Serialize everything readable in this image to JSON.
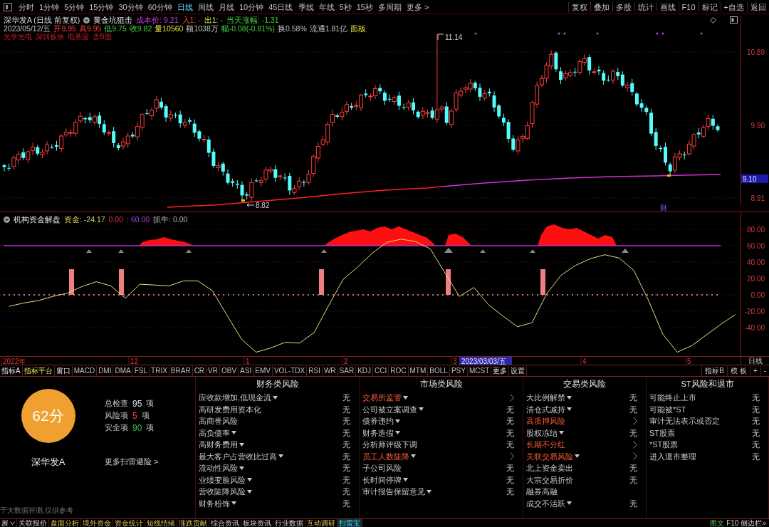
{
  "toolbar": {
    "periods": [
      {
        "label": "分时",
        "selected": false
      },
      {
        "label": "1分钟",
        "selected": false
      },
      {
        "label": "5分钟",
        "selected": false
      },
      {
        "label": "15分钟",
        "selected": false
      },
      {
        "label": "30分钟",
        "selected": false
      },
      {
        "label": "60分钟",
        "selected": false
      },
      {
        "label": "日线",
        "selected": true
      },
      {
        "label": "周线",
        "selected": false
      },
      {
        "label": "月线",
        "selected": false
      },
      {
        "label": "10分钟",
        "selected": false
      },
      {
        "label": "45日线",
        "selected": false
      },
      {
        "label": "季线",
        "selected": false
      },
      {
        "label": "年线",
        "selected": false
      },
      {
        "label": "5秒",
        "selected": false
      },
      {
        "label": "15秒",
        "selected": false
      },
      {
        "label": "多周期",
        "selected": false
      },
      {
        "label": "更多 >",
        "selected": false
      }
    ],
    "actions": [
      "复权",
      "叠加",
      "多股",
      "统计",
      "画线",
      "F10",
      "标记",
      "+自选",
      "返回"
    ]
  },
  "quote_header": {
    "title": "深华发A (日线 前复权)",
    "formula": "黄金坑狙击",
    "signals": [
      {
        "text": "成本价: 9.21",
        "kind": "cost"
      },
      {
        "text": "入1: -",
        "kind": "entry"
      },
      {
        "text": "出1: -",
        "kind": "exit"
      },
      {
        "text": "当天涨幅: -1.31",
        "kind": "change"
      }
    ],
    "quote": [
      {
        "text": "2023/05/12/五",
        "kind": "plain"
      },
      {
        "text": "开9.95",
        "kind": "up"
      },
      {
        "text": "高9.95",
        "kind": "up"
      },
      {
        "text": "低9.75",
        "kind": "down"
      },
      {
        "text": "收9.82",
        "kind": "down"
      },
      {
        "text": "量10560",
        "kind": "volume"
      },
      {
        "text": "额1038万",
        "kind": "plain"
      },
      {
        "text": "幅-0.08(-0.81%)",
        "kind": "down"
      },
      {
        "text": "换0.58%",
        "kind": "plain"
      },
      {
        "text": "流通1.81亿",
        "kind": "plain"
      },
      {
        "text": "面板",
        "kind": "volume"
      }
    ],
    "tags": [
      "光学光电",
      "深圳板块",
      "电基固",
      "含B股"
    ]
  },
  "price_chart": {
    "axis_labels": [
      "10.89",
      "9.90",
      "8.91"
    ],
    "current_price": "9.10",
    "high_label": "11.14",
    "low_label": "8.82",
    "event_marker": "财"
  },
  "indicator": {
    "name": "机构资金解盘",
    "readouts": [
      {
        "text": "资金: -24.17",
        "kind": "fund"
      },
      {
        "text": "0.00",
        "kind": "signal"
      },
      {
        "text": ": 60.00",
        "kind": "level"
      },
      {
        "text": "抓牛: 0.00",
        "kind": "plain"
      }
    ],
    "chart_data": {
      "type": "line",
      "grid": true,
      "ylim": [
        -74.8,
        100.9
      ],
      "yticks": [
        {
          "value": 80,
          "label": "80.00"
        },
        {
          "value": 60,
          "label": "60.00"
        },
        {
          "value": 40,
          "label": "40.00"
        },
        {
          "value": 20,
          "label": "20.00"
        },
        {
          "value": 0,
          "label": "0.00"
        },
        {
          "value": -20,
          "label": "-20.00"
        },
        {
          "value": -40,
          "label": "-40.00"
        }
      ],
      "ref_lines": [
        {
          "axis": "y",
          "value": 60,
          "color": "#b030d0"
        },
        {
          "axis": "y",
          "value": 0,
          "color": "#f0a0a0"
        }
      ],
      "series": [
        {
          "color": "#e8e080",
          "values": [
            -14,
            -10,
            -7,
            -2,
            2,
            10,
            16,
            11,
            -4,
            13,
            12,
            11,
            17,
            17,
            5,
            -25,
            -54,
            -70,
            -65,
            -58,
            -59,
            -46,
            -13,
            19,
            34,
            51,
            64,
            68,
            65,
            56,
            27,
            -2,
            9,
            -12,
            -26,
            -39,
            -34,
            1,
            24,
            36,
            44,
            49,
            45,
            30,
            -6,
            -48,
            -70,
            -62,
            -49,
            -36,
            -24
          ]
        }
      ]
    }
  },
  "time_axis": {
    "labels": [
      "2022年",
      "12",
      "1",
      "2",
      "3",
      "4",
      "5"
    ],
    "cursor_date": "2023/03/03/五",
    "period": "日线"
  },
  "indicator_tabs": {
    "left": [
      {
        "label": "指标A",
        "kind": "menu"
      },
      {
        "label": "指标平台",
        "kind": "platform"
      },
      {
        "label": "窗口",
        "kind": "menu"
      },
      {
        "label": "MACD",
        "kind": "formula"
      },
      {
        "label": "DMI",
        "kind": "formula"
      },
      {
        "label": "DMA",
        "kind": "formula"
      },
      {
        "label": "FSL",
        "kind": "formula"
      },
      {
        "label": "TRIX",
        "kind": "formula"
      },
      {
        "label": "BRAR",
        "kind": "formula"
      },
      {
        "label": "CR",
        "kind": "formula"
      },
      {
        "label": "VR",
        "kind": "formula"
      },
      {
        "label": "OBV",
        "kind": "formula"
      },
      {
        "label": "ASI",
        "kind": "formula"
      },
      {
        "label": "EMV",
        "kind": "formula"
      },
      {
        "label": "VOL-TDX",
        "kind": "formula"
      },
      {
        "label": "RSI",
        "kind": "formula"
      },
      {
        "label": "WR",
        "kind": "formula"
      },
      {
        "label": "SAR",
        "kind": "formula"
      },
      {
        "label": "KDJ",
        "kind": "formula"
      },
      {
        "label": "CCI",
        "kind": "formula"
      },
      {
        "label": "ROC",
        "kind": "formula"
      },
      {
        "label": "MTM",
        "kind": "formula"
      },
      {
        "label": "BOLL",
        "kind": "formula"
      },
      {
        "label": "PSY",
        "kind": "formula"
      },
      {
        "label": "MCST",
        "kind": "formula"
      },
      {
        "label": "更多",
        "kind": "menu"
      },
      {
        "label": "设置",
        "kind": "menu"
      }
    ],
    "right": [
      "指标B",
      "模 板",
      "+",
      "-"
    ]
  },
  "risk_scan": {
    "score": "62分",
    "stock": "深华发A",
    "stats": [
      {
        "label": "总检查",
        "value": "95",
        "unit": "项",
        "kind": "total"
      },
      {
        "label": "风险项",
        "value": "5",
        "unit": "项",
        "kind": "risk"
      },
      {
        "label": "安全项",
        "value": "90",
        "unit": "项",
        "kind": "safe"
      }
    ],
    "more_link": "更多扫雷避险 >",
    "disclaimer": "于大数据评测,仅供参考",
    "columns": [
      {
        "title": "财务类风险",
        "items": [
          {
            "label": "应收款增加,低现金流",
            "expandable": true,
            "flagged": false,
            "result": "无"
          },
          {
            "label": "高研发费用资本化",
            "expandable": false,
            "flagged": false,
            "result": "无"
          },
          {
            "label": "高商誉风险",
            "expandable": false,
            "flagged": false,
            "result": "无"
          },
          {
            "label": "高负债率",
            "expandable": true,
            "flagged": false,
            "result": "无"
          },
          {
            "label": "高财务费用",
            "expandable": true,
            "flagged": false,
            "result": "无"
          },
          {
            "label": "最大客户占营收比过高",
            "expandable": true,
            "flagged": false,
            "result": "无"
          },
          {
            "label": "流动性风险",
            "expandable": true,
            "flagged": false,
            "result": "无"
          },
          {
            "label": "业绩变脸风险",
            "expandable": true,
            "flagged": false,
            "result": "无"
          },
          {
            "label": "营收陡降风险",
            "expandable": true,
            "flagged": false,
            "result": "无"
          },
          {
            "label": "财务粉饰",
            "expandable": true,
            "flagged": false,
            "result": "无"
          }
        ]
      },
      {
        "title": "市场类风险",
        "items": [
          {
            "label": "交易所监管",
            "expandable": true,
            "flagged": true
          },
          {
            "label": "公司被立案调查",
            "expandable": true,
            "flagged": false,
            "result": "无"
          },
          {
            "label": "债券违约",
            "expandable": true,
            "flagged": false,
            "result": "无"
          },
          {
            "label": "财务造假",
            "expandable": true,
            "flagged": false,
            "result": "无"
          },
          {
            "label": "分析师评级下调",
            "expandable": false,
            "flagged": false,
            "result": "无"
          },
          {
            "label": "员工人数陡降",
            "expandable": true,
            "flagged": true
          },
          {
            "label": "子公司风险",
            "expandable": false,
            "flagged": false,
            "result": "无"
          },
          {
            "label": "长时间停牌",
            "expandable": true,
            "flagged": false,
            "result": "无"
          },
          {
            "label": "审计报告保留意见",
            "expandable": true,
            "flagged": false,
            "result": "无"
          }
        ]
      },
      {
        "title": "交易类风险",
        "items": [
          {
            "label": "大比例解禁",
            "expandable": true,
            "flagged": false,
            "result": "无"
          },
          {
            "label": "清仓式减持",
            "expandable": true,
            "flagged": false,
            "result": "无"
          },
          {
            "label": "高质押风险",
            "expandable": false,
            "flagged": true
          },
          {
            "label": "股权冻结",
            "expandable": true,
            "flagged": false,
            "result": "无"
          },
          {
            "label": "长期不分红",
            "expandable": false,
            "flagged": true
          },
          {
            "label": "关联交易风险",
            "expandable": true,
            "flagged": true
          },
          {
            "label": "北上资金卖出",
            "expandable": false,
            "flagged": false,
            "result": "无"
          },
          {
            "label": "大宗交易折价",
            "expandable": false,
            "flagged": false,
            "result": "无"
          },
          {
            "label": "融券高融",
            "expandable": false,
            "flagged": false
          },
          {
            "label": "成交不活跃",
            "expandable": true,
            "flagged": false,
            "result": "无"
          }
        ]
      },
      {
        "title": "ST风险和退市",
        "items": [
          {
            "label": "可能终止上市",
            "expandable": false,
            "flagged": false,
            "result": "无"
          },
          {
            "label": "可能被*ST",
            "expandable": false,
            "flagged": false,
            "result": "无"
          },
          {
            "label": "审计无法表示或否定",
            "expandable": false,
            "flagged": false,
            "result": "无"
          },
          {
            "label": "ST股票",
            "expandable": false,
            "flagged": false,
            "result": "无"
          },
          {
            "label": "*ST股票",
            "expandable": false,
            "flagged": false,
            "result": "无"
          },
          {
            "label": "进入退市整理",
            "expandable": false,
            "flagged": false,
            "result": "无"
          }
        ]
      }
    ]
  },
  "bottom_tabs": {
    "items": [
      {
        "label": "展",
        "selected": false,
        "kind": "info"
      },
      {
        "label": "关联报价",
        "selected": false,
        "kind": "info"
      },
      {
        "label": "盘面分析",
        "selected": false,
        "kind": "data"
      },
      {
        "label": "境外资金",
        "selected": false,
        "kind": "data"
      },
      {
        "label": "资金统计",
        "selected": false,
        "kind": "data"
      },
      {
        "label": "短线情绪",
        "selected": false,
        "kind": "data"
      },
      {
        "label": "涨跌贡献",
        "selected": false,
        "kind": "data"
      },
      {
        "label": "综合资讯",
        "selected": false,
        "kind": "info"
      },
      {
        "label": "板块资讯",
        "selected": false,
        "kind": "info"
      },
      {
        "label": "行业数据",
        "selected": false,
        "kind": "info"
      },
      {
        "label": "互动调研",
        "selected": false,
        "kind": "data"
      },
      {
        "label": "扫雷宝",
        "selected": true,
        "kind": "scan"
      }
    ],
    "right": [
      {
        "text": "图文",
        "kind": "accent"
      },
      {
        "text": "F10",
        "kind": "plain"
      },
      {
        "text": "侧边栏»",
        "kind": "plain"
      }
    ]
  }
}
